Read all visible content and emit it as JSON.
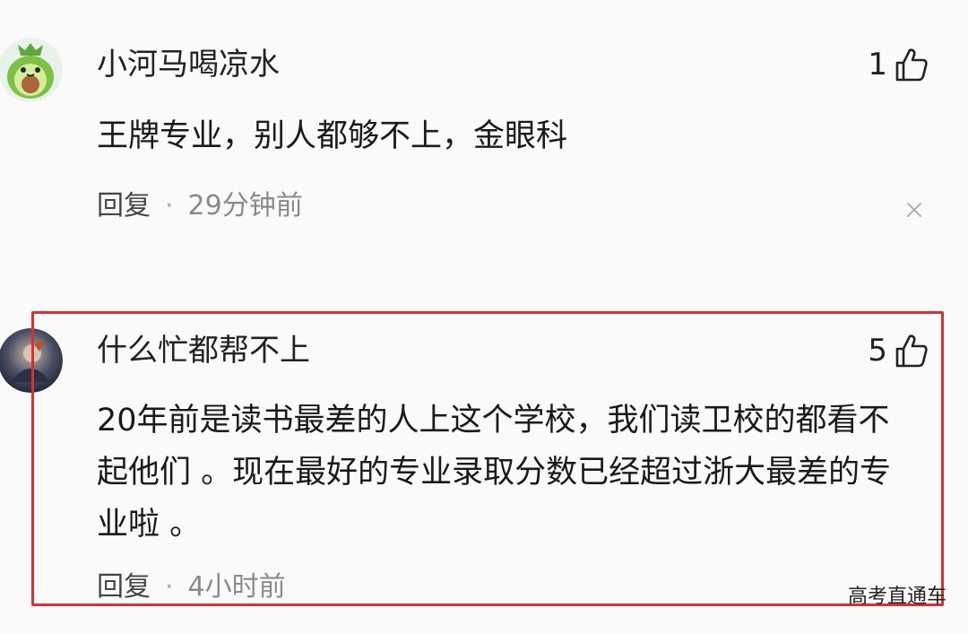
{
  "comments": [
    {
      "username": "小河马喝凉水",
      "avatar_icon": "avocado-avatar-icon",
      "likes": "1",
      "text": "王牌专业，别人都够不上，金眼科",
      "reply_label": "回复",
      "separator": "·",
      "time": "29分钟前"
    },
    {
      "username": "什么忙都帮不上",
      "avatar_icon": "user-photo-avatar-icon",
      "likes": "5",
      "text": "20年前是读书最差的人上这个学校，我们读卫校的都看不起他们 。现在最好的专业录取分数已经超过浙大最差的专业啦 。",
      "reply_label": "回复",
      "separator": "·",
      "time": "4小时前"
    }
  ],
  "watermark": "高考直通车",
  "colors": {
    "highlight_border": "#d9312f",
    "background": "#fafafa",
    "avocado_green": "#7cc247"
  }
}
